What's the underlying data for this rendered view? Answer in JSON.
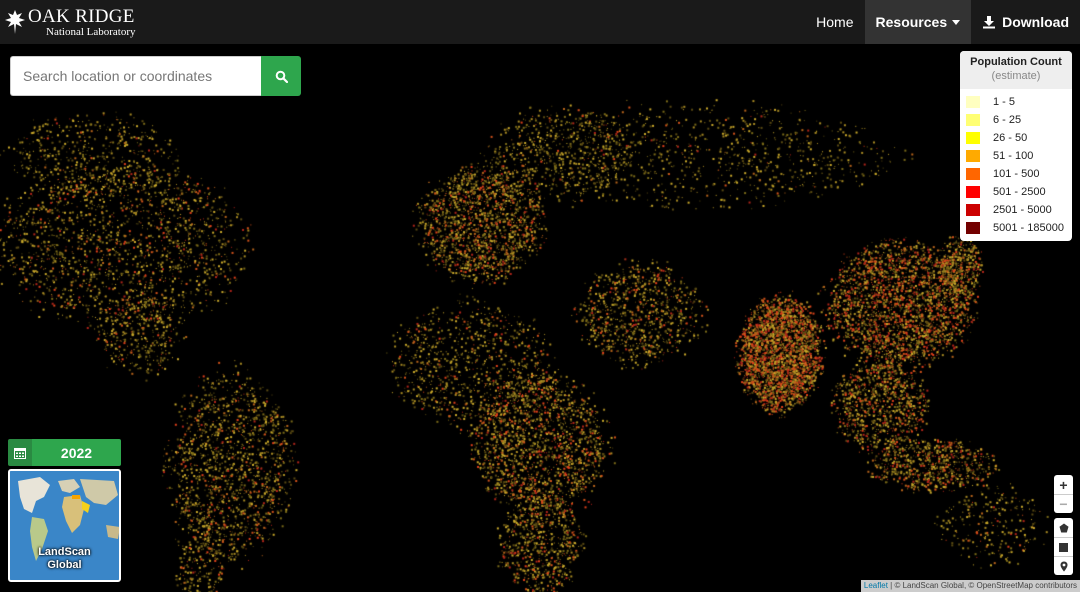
{
  "header": {
    "logo_main": "OAK RIDGE",
    "logo_sub": "National Laboratory",
    "nav": {
      "home": "Home",
      "resources": "Resources",
      "download": "Download"
    }
  },
  "search": {
    "placeholder": "Search location or coordinates"
  },
  "legend": {
    "title": "Population Count",
    "subtitle": "(estimate)",
    "items": [
      {
        "label": "1 - 5",
        "color": "#ffffc0"
      },
      {
        "label": "6 - 25",
        "color": "#ffff73"
      },
      {
        "label": "26 - 50",
        "color": "#ffff00"
      },
      {
        "label": "51 - 100",
        "color": "#ffaa00"
      },
      {
        "label": "101 - 500",
        "color": "#ff6600"
      },
      {
        "label": "501 - 2500",
        "color": "#ff0000"
      },
      {
        "label": "2501 - 5000",
        "color": "#cc0000"
      },
      {
        "label": "5001 - 185000",
        "color": "#730000"
      }
    ]
  },
  "year_selector": {
    "year": "2022"
  },
  "basemap": {
    "label_line1": "LandScan",
    "label_line2": "Global"
  },
  "zoom": {
    "plus": "+",
    "minus": "−"
  },
  "attribution": {
    "leaflet": "Leaflet",
    "text": " | © LandScan Global, © OpenStreetMap contributors"
  },
  "icons": {
    "search": "search-icon",
    "calendar": "calendar-icon",
    "download": "download-icon",
    "polygon": "polygon-icon",
    "rectangle": "rectangle-icon",
    "marker": "marker-icon"
  },
  "colors": {
    "accent_green": "#2ea64d",
    "topbar": "#1a1a1a"
  }
}
